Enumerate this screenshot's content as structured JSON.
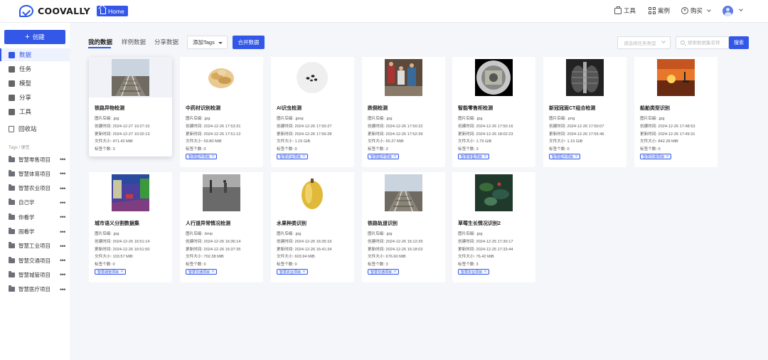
{
  "header": {
    "brand": "COOVALLY",
    "home_label": "Home",
    "tools_label": "工具",
    "cases_label": "案例",
    "buy_label": "购买"
  },
  "sidebar": {
    "create_label": "创建",
    "nav": [
      {
        "label": "数据",
        "icon": "data-icon",
        "active": true
      },
      {
        "label": "任务",
        "icon": "task-icon",
        "active": false
      },
      {
        "label": "模型",
        "icon": "model-icon",
        "active": false
      },
      {
        "label": "分享",
        "icon": "share-icon",
        "active": false
      },
      {
        "label": "工具",
        "icon": "tool-icon",
        "active": false
      },
      {
        "label": "回收站",
        "icon": "trash-icon",
        "active": false
      }
    ],
    "tags_label": "Tags / 便签",
    "folders": [
      "智慧零售项目",
      "智慧体育项目",
      "智慧农业项目",
      "自己学",
      "你看学",
      "国看学",
      "智慧工业项目",
      "智慧交通项目",
      "智慧城管项目",
      "智慧医疗项目"
    ],
    "more_label": "•••"
  },
  "toolbar": {
    "tabs": [
      "我的数据",
      "样例数据",
      "分享数据"
    ],
    "add_tags_label": "添加Tags",
    "merge_label": "合并数据",
    "type_placeholder": "请选择任务类型",
    "search_placeholder": "搜索数据集名称",
    "search_button": "搜索"
  },
  "labels": {
    "format": "图片后缀: ",
    "created": "创建时间: ",
    "updated": "更新时间: ",
    "size": "文件大小: ",
    "tags": "标签个数: "
  },
  "cards": [
    {
      "title": "铁路异物检测",
      "format": ".jpg",
      "created": "2024-12-27 10:27:10",
      "updated": "2024-12-27 10:32:13",
      "size": "471.42 MiB",
      "tags": "3",
      "badge": "",
      "thumb": "railway"
    },
    {
      "title": "中药材识别检测",
      "format": ".jpg",
      "created": "2024-12-26 17:53:31",
      "updated": "2024-12-26 17:51:12",
      "size": "59.80 MiB",
      "tags": "0",
      "badge": "智慧医疗项目",
      "thumb": "herb"
    },
    {
      "title": "AI识虫检测",
      "format": ".jpeg",
      "created": "2024-12-26 17:50:27",
      "updated": "2024-12-26 17:56:28",
      "size": "1.15 GiB",
      "tags": "0",
      "badge": "智慧农业项目",
      "thumb": "insects"
    },
    {
      "title": "跌倒检测",
      "format": ".jpg",
      "created": "2024-12-26 17:50:22",
      "updated": "2024-12-26 17:52:39",
      "size": "65.27 MiB",
      "tags": "3",
      "badge": "智慧医疗项目",
      "thumb": "people"
    },
    {
      "title": "智能零售柜检测",
      "format": ".jpg",
      "created": "2024-12-26 17:50:16",
      "updated": "2024-12-26 18:02:23",
      "size": "1.79 GiB",
      "tags": "3",
      "badge": "智慧零售项目",
      "thumb": "fisheye"
    },
    {
      "title": "新冠冠面CT组合检测",
      "format": ".png",
      "created": "2024-12-26 17:50:07",
      "updated": "2024-12-26 17:55:46",
      "size": "1.15 GiB",
      "tags": "0",
      "badge": "智慧医疗项目",
      "thumb": "xray"
    },
    {
      "title": "船舶类型识别",
      "format": ".jpg",
      "created": "2024-12-26 17:48:53",
      "updated": "2024-12-26 17:49:31",
      "size": "842.28 MiB",
      "tags": "0",
      "badge": "智慧交通项目",
      "thumb": "sunset"
    },
    {
      "title": "城市语义分割数据集",
      "format": ".jpg",
      "created": "2024-12-26 16:51:14",
      "updated": "2024-12-26 16:51:50",
      "size": "103.57 MiB",
      "tags": "0",
      "badge": "智慧城管项目",
      "thumb": "segment"
    },
    {
      "title": "人行道异常情况检测",
      "format": ".bmp",
      "created": "2024-12-26 16:36:14",
      "updated": "2024-12-26 16:37:35",
      "size": "702.38 MiB",
      "tags": "0",
      "badge": "智慧交通项目",
      "thumb": "street"
    },
    {
      "title": "水果种类识别",
      "format": ".jpg",
      "created": "2024-12-26 16:35:16",
      "updated": "2024-12-26 16:41:34",
      "size": "603.94 MiB",
      "tags": "0",
      "badge": "智慧农业项目",
      "thumb": "fruit"
    },
    {
      "title": "铁路轨道识别",
      "format": ".jpg",
      "created": "2024-12-26 16:12:29",
      "updated": "2024-12-26 16:18:03",
      "size": "676.60 MiB",
      "tags": "3",
      "badge": "智慧交通项目",
      "thumb": "railway"
    },
    {
      "title": "草莓生长情况识别2",
      "format": ".jpg",
      "created": "2024-12-25 17:30:17",
      "updated": "2024-12-25 17:33:44",
      "size": "76.42 MiB",
      "tags": "3",
      "badge": "智慧农业项目",
      "thumb": "leaves"
    }
  ]
}
